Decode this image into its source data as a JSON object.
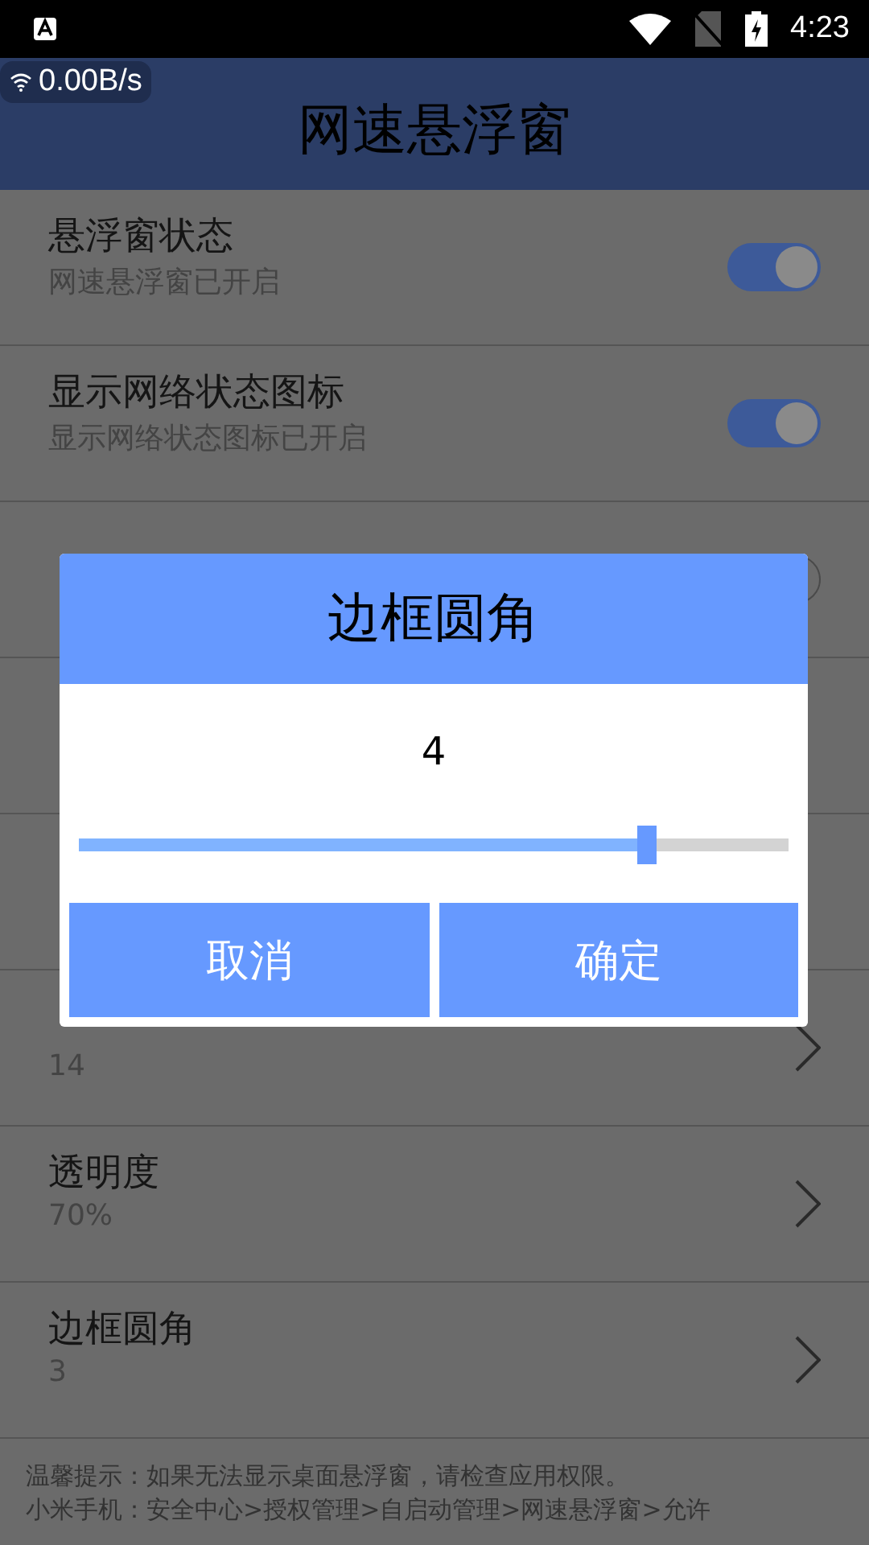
{
  "status_bar": {
    "time": "4:23"
  },
  "speed_badge": {
    "text": "0.00B/s"
  },
  "header": {
    "title": "网速悬浮窗"
  },
  "settings": [
    {
      "kind": "switch",
      "title": "悬浮窗状态",
      "subtitle": "网速悬浮窗已开启",
      "on": true
    },
    {
      "kind": "switch",
      "title": "显示网络状态图标",
      "subtitle": "显示网络状态图标已开启",
      "on": true
    },
    {
      "kind": "switch",
      "on": false
    },
    {
      "kind": "covered"
    },
    {
      "kind": "covered"
    },
    {
      "kind": "arrow",
      "subtitle": "14"
    },
    {
      "kind": "arrow",
      "title": "透明度",
      "subtitle": "70%"
    },
    {
      "kind": "arrow",
      "title": "边框圆角",
      "subtitle": "3"
    }
  ],
  "tips": [
    "温馨提示：如果无法显示桌面悬浮窗，请检查应用权限。",
    "小米手机：安全中心>授权管理>自启动管理>网速悬浮窗>允许"
  ],
  "dialog": {
    "title": "边框圆角",
    "value": "4",
    "level": 0.8,
    "buttons": [
      "取消",
      "确定"
    ]
  }
}
